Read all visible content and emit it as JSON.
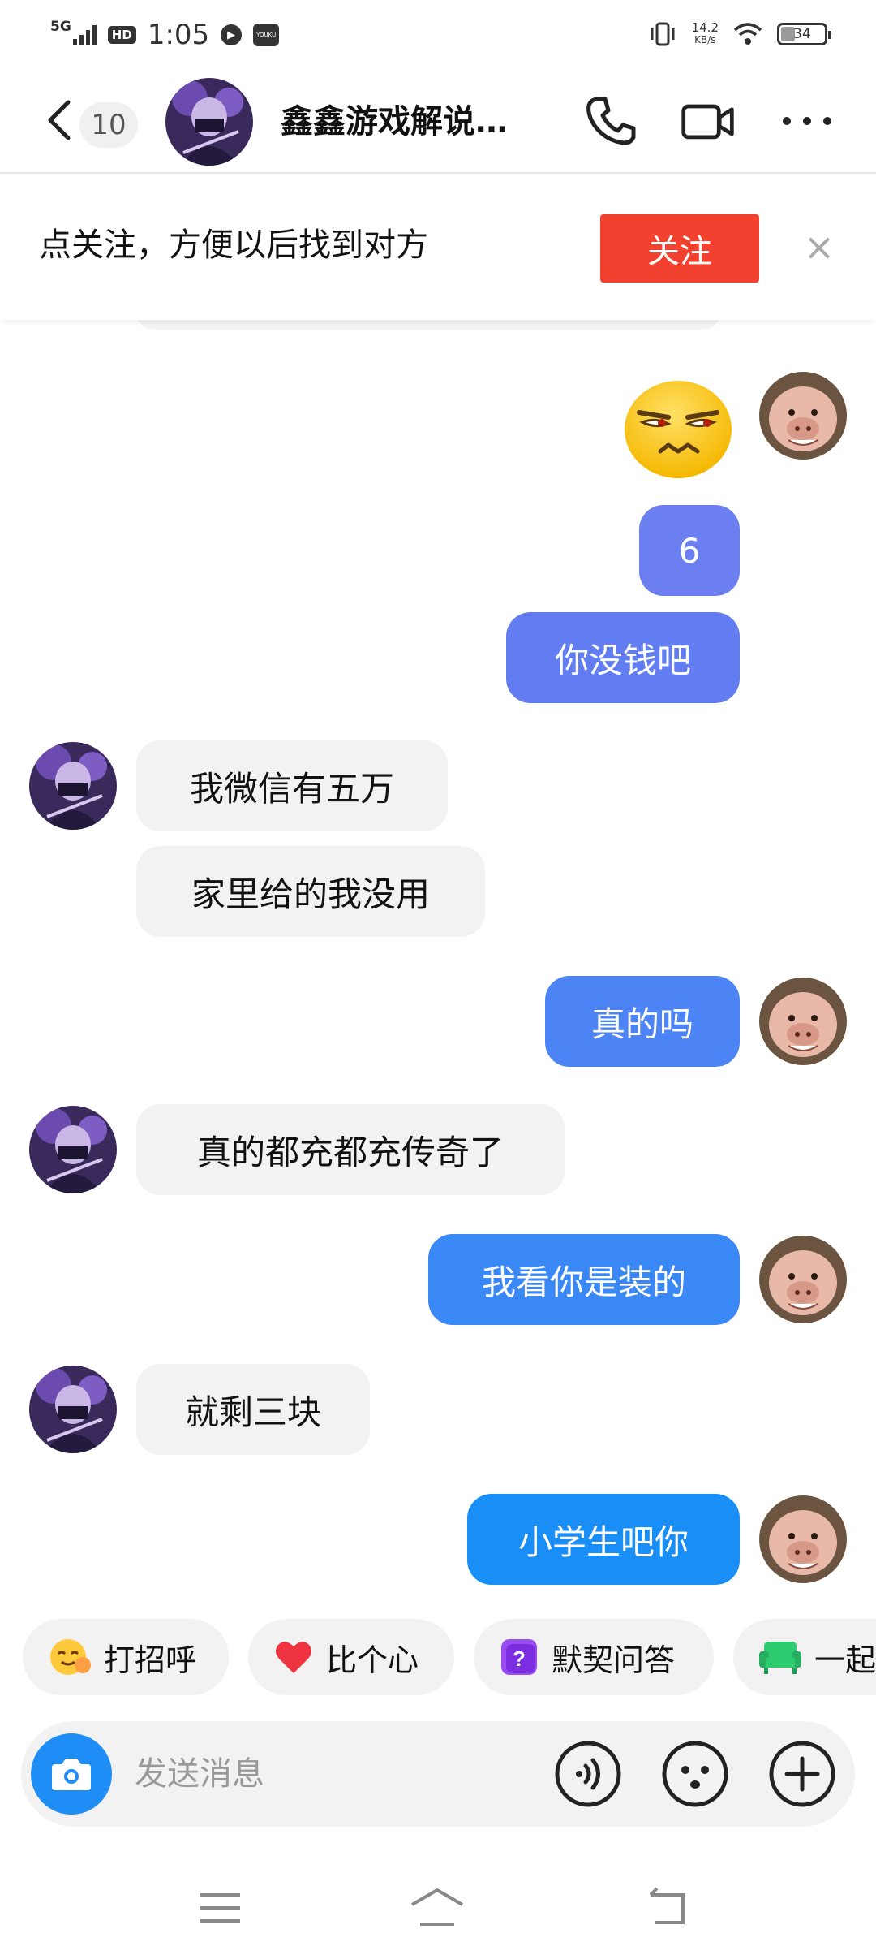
{
  "status_bar": {
    "network": "5G",
    "hd": "HD",
    "time": "1:05",
    "app_badge": "YOUKU",
    "speed_value": "14.2",
    "speed_unit": "KB/s",
    "battery": "34"
  },
  "header": {
    "unread_count": "10",
    "title": "鑫鑫游戏解说…"
  },
  "follow_banner": {
    "text": "点关注，方便以后找到对方",
    "button": "关注",
    "close": "×"
  },
  "messages": [
    {
      "side": "out",
      "type": "emoji",
      "content": "smirk-emoji"
    },
    {
      "side": "out",
      "text": "6",
      "color": "#6b7ff0"
    },
    {
      "side": "out",
      "text": "你没钱吧",
      "color": "#627df2"
    },
    {
      "side": "in",
      "text": "我微信有五万"
    },
    {
      "side": "in",
      "text": "家里给的我没用"
    },
    {
      "side": "out",
      "text": "真的吗",
      "color": "#4c83f5"
    },
    {
      "side": "in",
      "text": "真的都充都充传奇了"
    },
    {
      "side": "out",
      "text": "我看你是装的",
      "color": "#3a87f6"
    },
    {
      "side": "in",
      "text": "就剩三块"
    },
    {
      "side": "out",
      "text": "小学生吧你",
      "color": "#1a8ef7"
    }
  ],
  "quick_actions": [
    {
      "label": "打招呼",
      "icon": "greeting-emoji-icon"
    },
    {
      "label": "比个心",
      "icon": "heart-icon"
    },
    {
      "label": "默契问答",
      "icon": "question-icon"
    },
    {
      "label": "一起",
      "icon": "sofa-icon"
    }
  ],
  "input": {
    "placeholder": "发送消息"
  },
  "colors": {
    "follow_button": "#f2422f",
    "camera_button": "#1e8ef6"
  }
}
